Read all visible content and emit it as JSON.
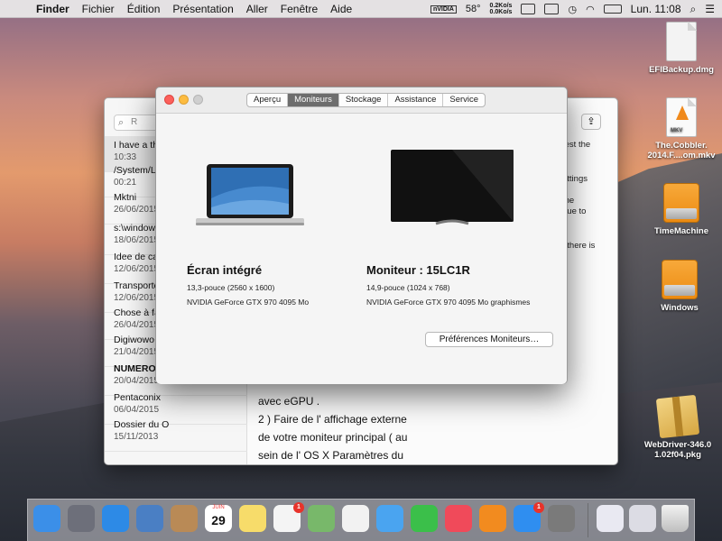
{
  "menubar": {
    "app_name": "Finder",
    "items": [
      "Fichier",
      "Édition",
      "Présentation",
      "Aller",
      "Fenêtre",
      "Aide"
    ],
    "status": {
      "gpu_label": "nVIDIA",
      "temperature": "58°",
      "net_up": "0.2Ko/s",
      "net_down": "0.0Ko/s",
      "clock": "Lun. 11:08"
    }
  },
  "desktop_icons": [
    {
      "label": "EFIBackup.dmg"
    },
    {
      "label": "The.Cobbler.\n2014.F....om.mkv",
      "badge": "MKV"
    },
    {
      "label": "TimeMachine"
    },
    {
      "label": "Windows"
    },
    {
      "label": "WebDriver-346.0\n1.02f04.pkg"
    }
  ],
  "notes": {
    "search_placeholder": "R",
    "items": [
      {
        "title": "I have a th",
        "date": "10:33"
      },
      {
        "title": "/System/L",
        "date": "00:21"
      },
      {
        "title": "Mktni",
        "date": "26/06/2015"
      },
      {
        "title": "s:\\window",
        "date": "18/06/2015"
      },
      {
        "title": "Idee de ca",
        "date": "12/06/2015"
      },
      {
        "title": "Transporte",
        "date": "12/06/2015"
      },
      {
        "title": "Chose à fa",
        "date": "26/04/2015"
      },
      {
        "title": "Digiwowo",
        "date": "21/04/2015"
      },
      {
        "title": "NUMERO",
        "date": "20/04/2015"
      },
      {
        "title": "Pentaconix",
        "date": "06/04/2015"
      },
      {
        "title": "Dossier du O",
        "date": "15/11/2013"
      }
    ],
    "body_lines": [
      "avec eGPU .",
      "2 ) Faire de l' affichage externe",
      "de votre moniteur principal ( au",
      "sein de l' OS X Paramètres du"
    ],
    "right_fragments": [
      "test the",
      "ettings",
      "the",
      "due to",
      "t there is"
    ]
  },
  "about": {
    "tabs": [
      "Aperçu",
      "Moniteurs",
      "Stockage",
      "Assistance",
      "Service"
    ],
    "active_tab": "Moniteurs",
    "displays": [
      {
        "name": "Écran intégré",
        "resolution": "13,3-pouce (2560 x 1600)",
        "gpu": "NVIDIA GeForce GTX 970 4095 Mo"
      },
      {
        "name": "Moniteur : 15LC1R",
        "resolution": "14,9-pouce (1024 x 768)",
        "gpu": "NVIDIA GeForce GTX 970 4095 Mo graphismes"
      }
    ],
    "prefs_button": "Préférences Moniteurs…"
  },
  "dock": {
    "apps": [
      {
        "name": "finder-icon",
        "color": "#3b8fe8"
      },
      {
        "name": "launchpad-icon",
        "color": "#6d6f7a"
      },
      {
        "name": "safari-icon",
        "color": "#2d8ae6"
      },
      {
        "name": "mail-icon",
        "color": "#4a7fc4"
      },
      {
        "name": "contacts-icon",
        "color": "#b98a56"
      },
      {
        "name": "calendar-icon",
        "color": "#ffffff"
      },
      {
        "name": "notes-icon",
        "color": "#f7dc6a"
      },
      {
        "name": "reminders-icon",
        "color": "#f4f4f4"
      },
      {
        "name": "maps-icon",
        "color": "#78b86a"
      },
      {
        "name": "photos-icon",
        "color": "#f2f2f2"
      },
      {
        "name": "messages-icon",
        "color": "#4aa4f0"
      },
      {
        "name": "facetime-icon",
        "color": "#3bbf4a"
      },
      {
        "name": "itunes-icon",
        "color": "#f04a5a"
      },
      {
        "name": "ibooks-icon",
        "color": "#f28b1f"
      },
      {
        "name": "appstore-icon",
        "color": "#2f8ef0"
      },
      {
        "name": "system-preferences-icon",
        "color": "#7a7a7a"
      }
    ],
    "calendar": {
      "month": "JUIN",
      "day": "29"
    },
    "badges": {
      "reminders": "1",
      "appstore": "1"
    }
  }
}
